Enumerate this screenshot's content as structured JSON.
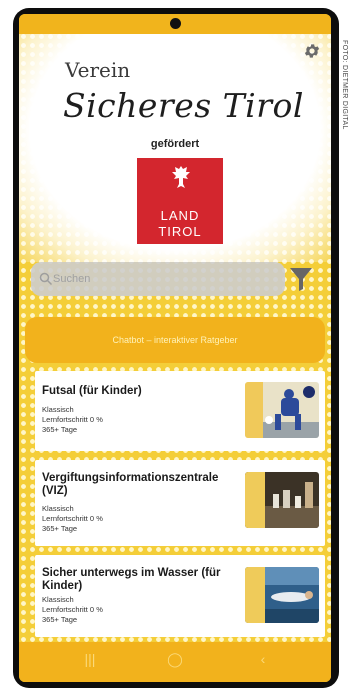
{
  "photo_credit": "FOTO: DIETMER DIGITAL",
  "header": {
    "verein": "Verein",
    "title": "Sicheres Tirol",
    "subtitle": "gefördert"
  },
  "logo": {
    "line1": "LAND",
    "line2": "TIROL"
  },
  "search": {
    "placeholder": "Suchen"
  },
  "advisor_button": {
    "label": "Chatbot – interaktiver Ratgeber"
  },
  "cards": [
    {
      "title": "Futsal (für Kinder)",
      "type": "Klassisch",
      "progress": "Lernfortschritt 0 %",
      "duration": "365+ Tage"
    },
    {
      "title": "Vergiftungsinformationszentrale (VIZ)",
      "type": "Klassisch",
      "progress": "Lernfortschritt 0 %",
      "duration": "365+ Tage"
    },
    {
      "title": "Sicher unterwegs im Wasser (für Kinder)",
      "type": "Klassisch",
      "progress": "Lernfortschritt 0 %",
      "duration": "365+ Tage"
    }
  ],
  "colors": {
    "accent": "#f2b21c",
    "logo_red": "#d3262e",
    "pattern": "#f4ce38"
  },
  "icons": {
    "settings": "gear-icon",
    "search": "search-icon",
    "filter": "filter-icon",
    "eagle": "eagle-icon"
  },
  "navbar": {
    "recents": "|||",
    "home": "◯",
    "back": "‹"
  }
}
